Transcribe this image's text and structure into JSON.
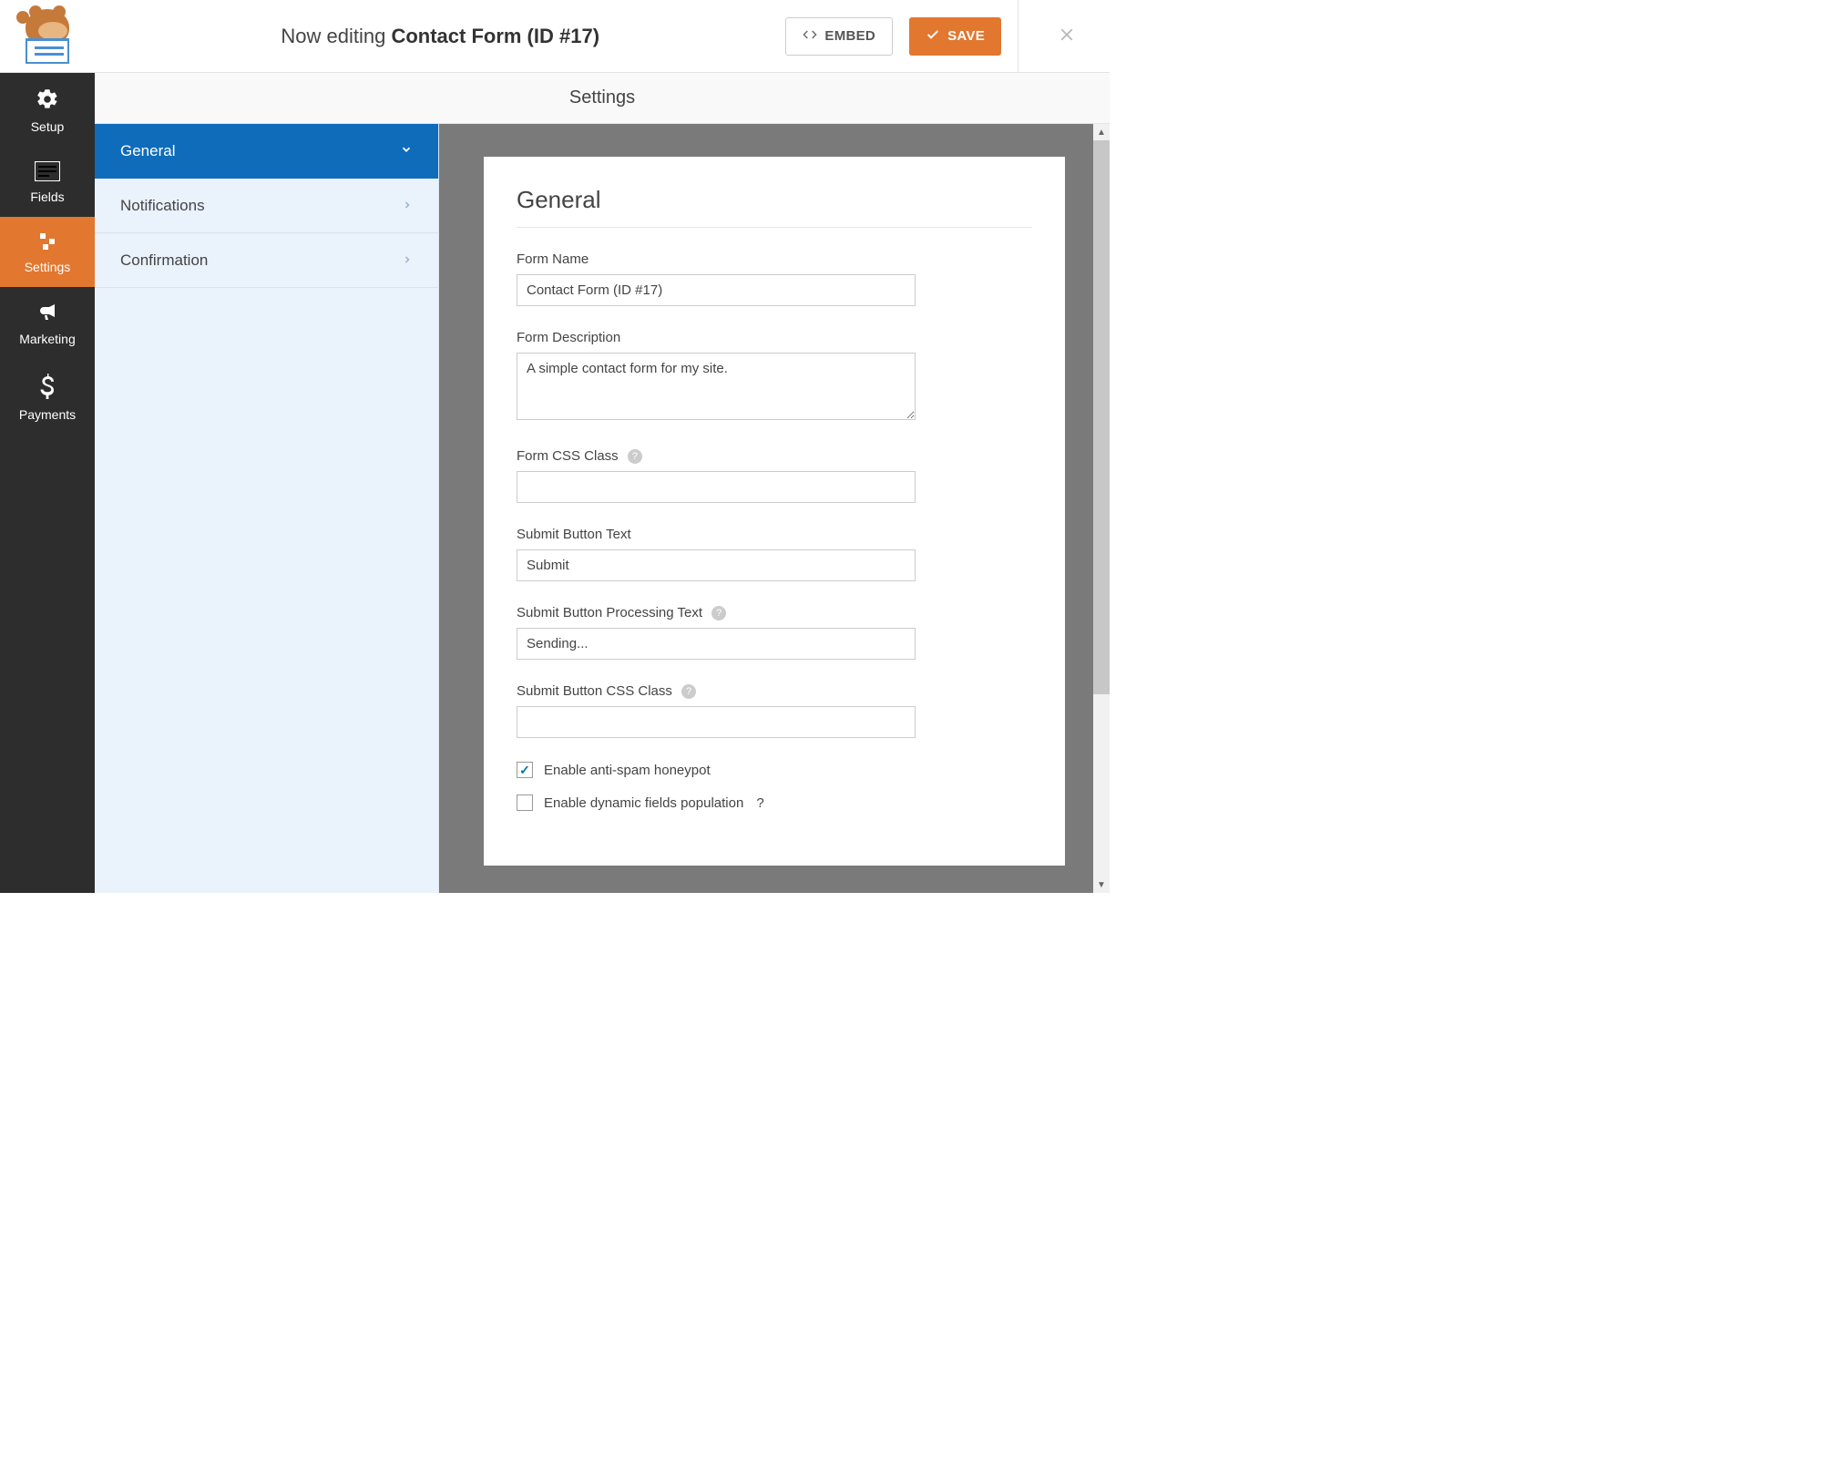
{
  "header": {
    "editing_prefix": "Now editing ",
    "editing_title": "Contact Form (ID #17)",
    "embed_label": "EMBED",
    "save_label": "SAVE"
  },
  "leftnav": {
    "setup": "Setup",
    "fields": "Fields",
    "settings": "Settings",
    "marketing": "Marketing",
    "payments": "Payments"
  },
  "page_title": "Settings",
  "subnav": {
    "general": "General",
    "notifications": "Notifications",
    "confirmation": "Confirmation"
  },
  "panel": {
    "heading": "General",
    "form_name_label": "Form Name",
    "form_name_value": "Contact Form (ID #17)",
    "form_desc_label": "Form Description",
    "form_desc_value": "A simple contact form for my site.",
    "form_css_label": "Form CSS Class",
    "form_css_value": "",
    "submit_text_label": "Submit Button Text",
    "submit_text_value": "Submit",
    "submit_proc_label": "Submit Button Processing Text",
    "submit_proc_value": "Sending...",
    "submit_css_label": "Submit Button CSS Class",
    "submit_css_value": "",
    "check_honeypot": "Enable anti-spam honeypot",
    "check_dynamic": "Enable dynamic fields population"
  }
}
